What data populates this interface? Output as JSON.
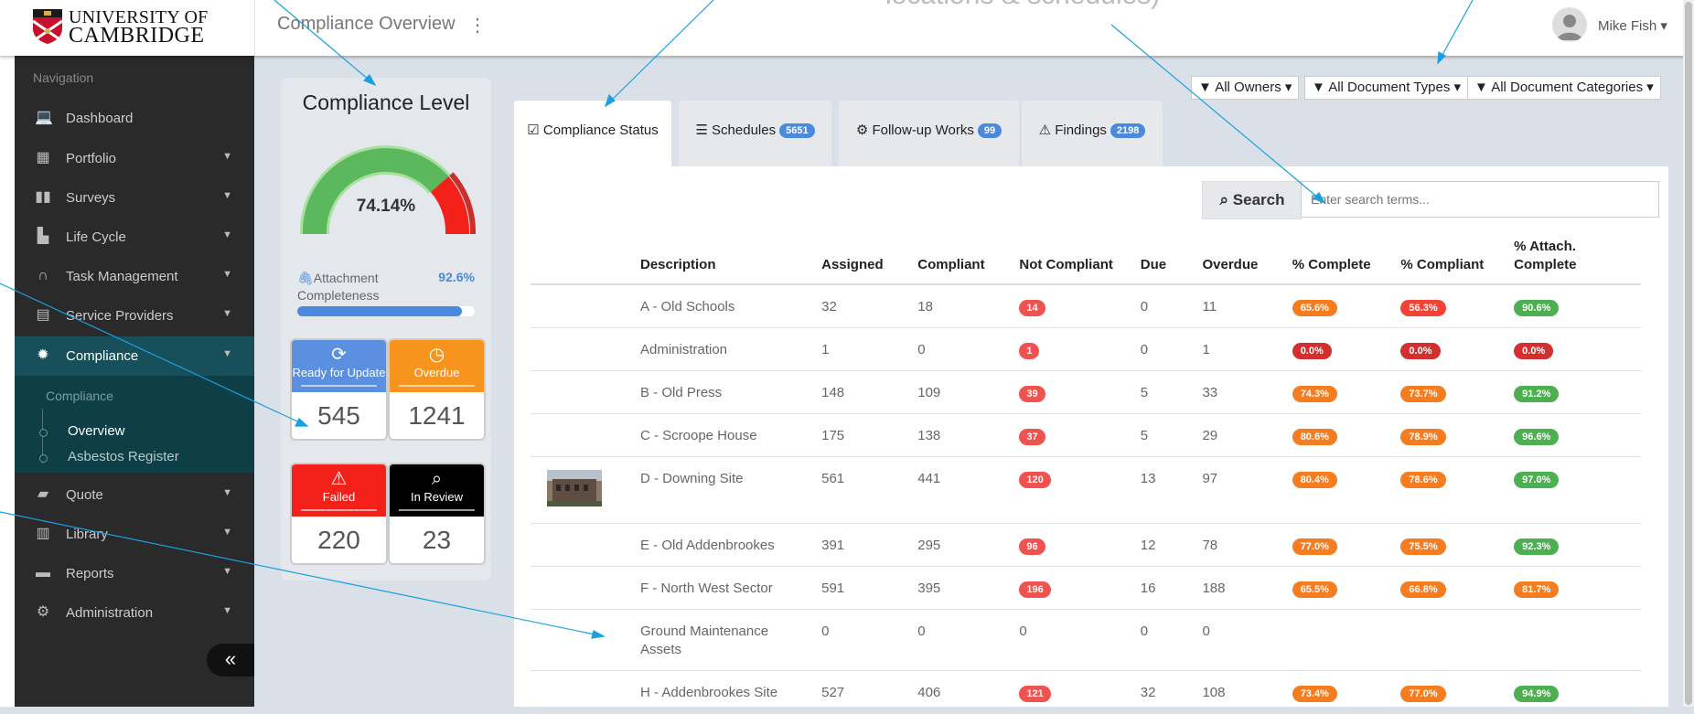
{
  "app": {
    "university_line1": "UNIVERSITY OF",
    "university_line2": "CAMBRIDGE",
    "page_title": "Compliance Overview",
    "page_title_menu": "⋮",
    "overlay_text": "locations & schedules)",
    "user_name": "Mike Fish ▾"
  },
  "sidebar": {
    "heading": "Navigation",
    "items": [
      {
        "label": "Dashboard",
        "icon": "laptop-icon",
        "glyph": "💻",
        "caret": ""
      },
      {
        "label": "Portfolio",
        "icon": "building-icon",
        "glyph": "▦",
        "caret": "▼"
      },
      {
        "label": "Surveys",
        "icon": "map-icon",
        "glyph": "▮▮",
        "caret": "▼"
      },
      {
        "label": "Life Cycle",
        "icon": "bar-chart-icon",
        "glyph": "▙",
        "caret": "▼"
      },
      {
        "label": "Task Management",
        "icon": "headset-icon",
        "glyph": "∩",
        "caret": "▼"
      },
      {
        "label": "Service Providers",
        "icon": "id-card-icon",
        "glyph": "▤",
        "caret": "▼"
      },
      {
        "label": "Compliance",
        "icon": "badge-icon",
        "glyph": "✹",
        "caret": "▼"
      },
      {
        "label": "Quote",
        "icon": "briefcase-icon",
        "glyph": "▰",
        "caret": "▼"
      },
      {
        "label": "Library",
        "icon": "book-icon",
        "glyph": "▥",
        "caret": "▼"
      },
      {
        "label": "Reports",
        "icon": "folder-icon",
        "glyph": "▬",
        "caret": "▼"
      },
      {
        "label": "Administration",
        "icon": "gears-icon",
        "glyph": "⚙",
        "caret": "▼"
      }
    ],
    "sub_heading": "Compliance",
    "sub_items": [
      "Overview",
      "Asbestos Register"
    ],
    "collapse": "«"
  },
  "level": {
    "title": "Compliance Level",
    "value_text": "74.14%",
    "value": 74.14,
    "attachment_label": "Attachment Completeness",
    "attachment_value": "92.6%",
    "attachment_fraction": 0.926,
    "tiles": [
      {
        "label": "Ready for Update",
        "value": "545",
        "color": "#5b8fe0",
        "icon": "refresh-icon",
        "glyph": "⟳"
      },
      {
        "label": "Overdue",
        "value": "1241",
        "color": "#f7941d",
        "icon": "clock-icon",
        "glyph": "◷"
      },
      {
        "label": "Failed",
        "value": "220",
        "color": "#f4211b",
        "icon": "warning-icon",
        "glyph": "⚠"
      },
      {
        "label": "In Review",
        "value": "23",
        "color": "#000000",
        "icon": "search-icon",
        "glyph": "⌕"
      }
    ]
  },
  "filters": [
    "All Owners",
    "All Document Types",
    "All Document Categories"
  ],
  "tabs": [
    {
      "label": "Compliance Status",
      "glyph": "☑",
      "icon": "check-square-icon",
      "badge": ""
    },
    {
      "label": "Schedules",
      "glyph": "☰",
      "icon": "list-icon",
      "badge": "5651"
    },
    {
      "label": "Follow-up Works",
      "glyph": "⚙",
      "icon": "cogs-icon",
      "badge": "99"
    },
    {
      "label": "Findings",
      "glyph": "⚠",
      "icon": "warning-icon",
      "badge": "2198"
    }
  ],
  "search": {
    "button": "Search",
    "placeholder": "Enter search terms..."
  },
  "table": {
    "headers": [
      "Description",
      "Assigned",
      "Compliant",
      "Not Compliant",
      "Due",
      "Overdue",
      "% Complete",
      "% Compliant",
      "% Attach. Complete"
    ],
    "rows": [
      {
        "desc": "A - Old Schools",
        "assigned": "32",
        "compliant": "18",
        "not": "14",
        "due": "0",
        "overdue": "11",
        "pc": "65.6%",
        "pcc": "orange",
        "pcomp": "56.3%",
        "pcompc": "red",
        "pa": "90.6%",
        "pac": "green",
        "thumb": false
      },
      {
        "desc": "Administration",
        "assigned": "1",
        "compliant": "0",
        "not": "1",
        "due": "0",
        "overdue": "1",
        "pc": "0.0%",
        "pcc": "dark",
        "pcomp": "0.0%",
        "pcompc": "dark",
        "pa": "0.0%",
        "pac": "dark",
        "thumb": false
      },
      {
        "desc": "B - Old Press",
        "assigned": "148",
        "compliant": "109",
        "not": "39",
        "due": "5",
        "overdue": "33",
        "pc": "74.3%",
        "pcc": "orange",
        "pcomp": "73.7%",
        "pcompc": "orange",
        "pa": "91.2%",
        "pac": "green",
        "thumb": false
      },
      {
        "desc": "C - Scroope House",
        "assigned": "175",
        "compliant": "138",
        "not": "37",
        "due": "5",
        "overdue": "29",
        "pc": "80.6%",
        "pcc": "orange",
        "pcomp": "78.9%",
        "pcompc": "orange",
        "pa": "96.6%",
        "pac": "green",
        "thumb": false
      },
      {
        "desc": "D - Downing Site",
        "assigned": "561",
        "compliant": "441",
        "not": "120",
        "due": "13",
        "overdue": "97",
        "pc": "80.4%",
        "pcc": "orange",
        "pcomp": "78.6%",
        "pcompc": "orange",
        "pa": "97.0%",
        "pac": "green",
        "thumb": true
      },
      {
        "desc": "E - Old Addenbrookes",
        "assigned": "391",
        "compliant": "295",
        "not": "96",
        "due": "12",
        "overdue": "78",
        "pc": "77.0%",
        "pcc": "orange",
        "pcomp": "75.5%",
        "pcompc": "orange",
        "pa": "92.3%",
        "pac": "green",
        "thumb": false
      },
      {
        "desc": "F - North West Sector",
        "assigned": "591",
        "compliant": "395",
        "not": "196",
        "due": "16",
        "overdue": "188",
        "pc": "65.5%",
        "pcc": "orange",
        "pcomp": "66.8%",
        "pcompc": "orange",
        "pa": "81.7%",
        "pac": "orange",
        "thumb": false
      },
      {
        "desc": "Ground Maintenance Assets",
        "assigned": "0",
        "compliant": "0",
        "not": "0",
        "due": "0",
        "overdue": "0",
        "pc": "",
        "pcc": "",
        "pcomp": "",
        "pcompc": "",
        "pa": "",
        "pac": "",
        "thumb": false
      },
      {
        "desc": "H - Addenbrookes Site",
        "assigned": "527",
        "compliant": "406",
        "not": "121",
        "due": "32",
        "overdue": "108",
        "pc": "73.4%",
        "pcc": "orange",
        "pcomp": "77.0%",
        "pcompc": "orange",
        "pa": "94.9%",
        "pac": "green",
        "thumb": false
      }
    ]
  },
  "colors": {
    "accent_blue": "#4a89dc",
    "sidebar_bg": "#2a2a2a",
    "active_nav": "#17505a",
    "gauge_green": "#5cb85c",
    "gauge_red": "#f4211b",
    "annotation_arrow": "#1a9fe0"
  }
}
